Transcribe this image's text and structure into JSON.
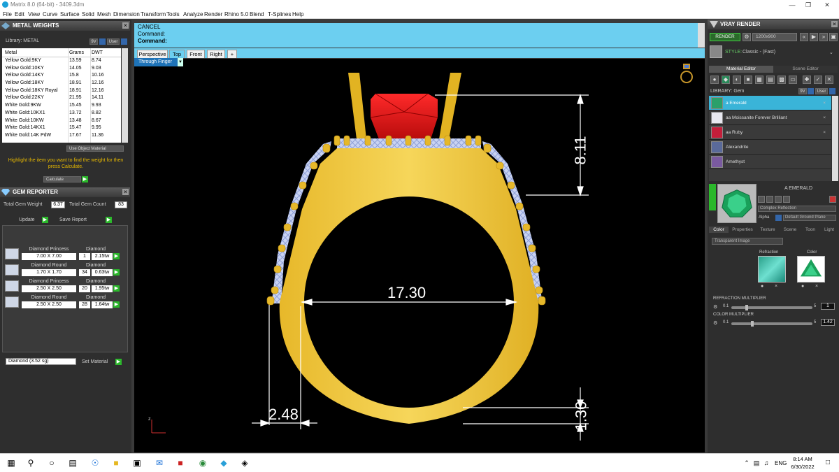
{
  "window": {
    "title": "Matrix 8.0 (64-bit) - 3409.3dm"
  },
  "menu": [
    "File",
    "Edit",
    "View",
    "Curve",
    "Surface",
    "Solid",
    "Mesh",
    "Dimension",
    "Transform",
    "Tools",
    "Analyze",
    "Render",
    "Rhino 5.0",
    "Blend",
    "T-Splines",
    "Help"
  ],
  "metal_weights": {
    "title": "METAL WEIGHTS",
    "library_label": "Library: METAL",
    "lib_btn_sv": "9V",
    "lib_btn_user": "User",
    "columns": [
      "Metal",
      "Grams",
      "DWT"
    ],
    "rows": [
      [
        "Yellow Gold:9KY",
        "13.59",
        "8.74"
      ],
      [
        "Yellow Gold:10KY",
        "14.05",
        "9.03"
      ],
      [
        "Yellow Gold:14KY",
        "15.8",
        "10.16"
      ],
      [
        "Yellow Gold:18KY",
        "18.91",
        "12.16"
      ],
      [
        "Yellow Gold:18KY Royal",
        "18.91",
        "12.16"
      ],
      [
        "Yellow Gold:22KY",
        "21.95",
        "14.11"
      ],
      [
        "White Gold:9KW",
        "15.45",
        "9.93"
      ],
      [
        "White Gold:10KX1",
        "13.72",
        "8.82"
      ],
      [
        "White Gold:10KW",
        "13.48",
        "8.67"
      ],
      [
        "White Gold:14KX1",
        "15.47",
        "9.95"
      ],
      [
        "White Gold:14K PdW",
        "17.67",
        "11.36"
      ]
    ],
    "use_object_material": "Use Object Material",
    "hint": "Highlight the item you want to find the weight for then press Calculate.",
    "calculate": "Calculate"
  },
  "gem_reporter": {
    "title": "GEM REPORTER",
    "total_weight_label": "Total Gem Weight",
    "total_weight": "6.37",
    "total_count_label": "Total Gem Count",
    "total_count": "83",
    "update": "Update",
    "save_report": "Save Report",
    "gems": [
      {
        "name": "Diamond Princess",
        "size": "7.00 X 7.00",
        "material": "Diamond",
        "count": "1",
        "weight": "2.15tw"
      },
      {
        "name": "Diamond Round",
        "size": "1.70 X 1.70",
        "material": "Diamond",
        "count": "34",
        "weight": "0.63tw"
      },
      {
        "name": "Diamond Princess",
        "size": "2.50 X 2.50",
        "material": "Diamond",
        "count": "20",
        "weight": "1.95tw"
      },
      {
        "name": "Diamond Round",
        "size": "2.50 X 2.50",
        "material": "Diamond",
        "count": "28",
        "weight": "1.64tw"
      }
    ],
    "material_select": "Diamond     (3.52 sg)",
    "set_material": "Set Material"
  },
  "command": {
    "line1": "CANCEL",
    "line2": "Command:",
    "line3": "Command:"
  },
  "viewport": {
    "tabs": [
      "Perspective",
      "Top",
      "Front",
      "Right",
      "+"
    ],
    "active_tab": "Top",
    "view_mode": "Through Finger",
    "dims": {
      "top_height": "8.11",
      "inner_diameter": "17.30",
      "shank_width": "2.48",
      "bottom_thickness": "1.30"
    },
    "axis_label": "z"
  },
  "vray": {
    "title": "VRAY RENDER",
    "render_btn": "RENDER",
    "resolution": "1200x900",
    "style_label": "STYLE:",
    "style_value": "Classic - (Fast)",
    "tabs": [
      "Material Editor",
      "Scene Editor"
    ],
    "library_label": "LIBRARY: Gem",
    "lib_btn_sv": "9V",
    "lib_btn_user": "User",
    "gems": [
      {
        "name": "a Emerald",
        "color": "#2aa06a",
        "selected": true,
        "x": "×"
      },
      {
        "name": "aa Moissanite Forever Brilliant",
        "color": "#e8e8f0",
        "selected": false,
        "x": "×"
      },
      {
        "name": "aa Ruby",
        "color": "#c41e3a",
        "selected": false,
        "x": "×"
      },
      {
        "name": "Alexandrite",
        "color": "#5a6a9a",
        "selected": false,
        "x": ""
      },
      {
        "name": "Amethyst",
        "color": "#7a5aa0",
        "selected": false,
        "x": ""
      }
    ],
    "preview_name": "A EMERALD",
    "mat_type": "Complex Reflection",
    "alpha_label": "Alpha",
    "ground": "Default Ground Plane",
    "tabs2": [
      "Color",
      "Properties",
      "Texture",
      "Scene",
      "Toon",
      "Light"
    ],
    "texture_select": "Transparent Image",
    "refraction_label": "Refraction",
    "color_label": "Color",
    "refraction_multiplier_label": "REFRACTION MULTIPLIER",
    "refraction_min": "0.1",
    "refraction_max": "5",
    "refraction_value": "1",
    "color_multiplier_label": "COLOR MULTIPLIER",
    "color_min": "0.1",
    "color_max": "5",
    "color_value": "1.42"
  },
  "taskbar": {
    "lang": "ENG",
    "time": "8:14 AM",
    "date": "6/30/2022"
  },
  "colors": {
    "gold": "#f2d24a",
    "accent": "#6ccff0",
    "ruby": "#e01e1e",
    "diamond": "#b9c6ee"
  }
}
